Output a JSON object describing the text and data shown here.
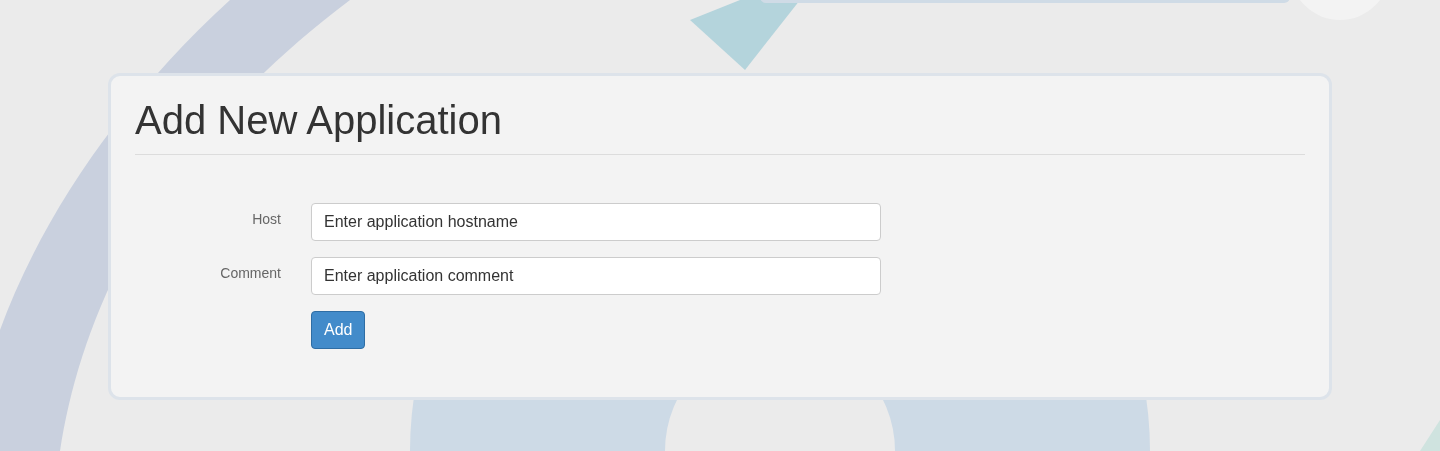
{
  "form": {
    "title": "Add New Application",
    "fields": [
      {
        "label": "Host",
        "value": "Enter application hostname"
      },
      {
        "label": "Comment",
        "value": "Enter application comment"
      }
    ],
    "submit": "Add"
  }
}
